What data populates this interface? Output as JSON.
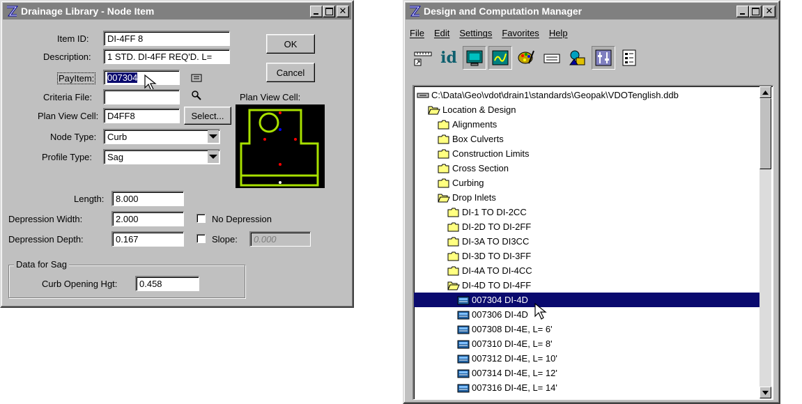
{
  "dialog": {
    "title": "Drainage Library - Node Item",
    "item_id_label": "Item ID:",
    "item_id_value": "DI-4FF 8",
    "description_label": "Description:",
    "description_value": "1 STD. DI-4FF REQ'D. L=",
    "payitem_label": "PayItem:",
    "payitem_value": "007304",
    "criteria_label": "Criteria File:",
    "criteria_value": "",
    "plan_view_cell_label": "Plan View Cell:",
    "plan_view_cell_value": "D4FF8",
    "select_label": "Select...",
    "ok_label": "OK",
    "cancel_label": "Cancel",
    "preview_label": "Plan View Cell:",
    "node_type_label": "Node Type:",
    "node_type_value": "Curb",
    "profile_type_label": "Profile Type:",
    "profile_type_value": "Sag",
    "length_label": "Length:",
    "length_value": "8.000",
    "dep_width_label": "Depression Width:",
    "dep_width_value": "2.000",
    "no_depression_label": "No Depression",
    "dep_depth_label": "Depression Depth:",
    "dep_depth_value": "0.167",
    "slope_label": "Slope:",
    "slope_value": "0.000",
    "group_title": "Data for Sag",
    "curb_opening_label": "Curb Opening Hgt:",
    "curb_opening_value": "0.458"
  },
  "manager": {
    "title": "Design and Computation Manager",
    "menu": [
      "File",
      "Edit",
      "Settings",
      "Favorites",
      "Help"
    ],
    "toolbar_icons": [
      "ruler-icon",
      "id-icon",
      "monitor-icon",
      "draw-icon",
      "palette-icon",
      "keyboard-icon",
      "shapes-icon",
      "settings-icon",
      "properties-icon"
    ],
    "id_text": "id",
    "tree": [
      {
        "label": "C:\\Data\\Geo\\vdot\\drain1\\standards\\Geopak\\VDOTenglish.ddb",
        "level": 0,
        "icon": "database",
        "selected": false
      },
      {
        "label": "Location & Design",
        "level": 1,
        "icon": "folder-open",
        "selected": false
      },
      {
        "label": "Alignments",
        "level": 2,
        "icon": "folder",
        "selected": false
      },
      {
        "label": "Box Culverts",
        "level": 2,
        "icon": "folder",
        "selected": false
      },
      {
        "label": "Construction Limits",
        "level": 2,
        "icon": "folder",
        "selected": false
      },
      {
        "label": "Cross Section",
        "level": 2,
        "icon": "folder",
        "selected": false
      },
      {
        "label": "Curbing",
        "level": 2,
        "icon": "folder",
        "selected": false
      },
      {
        "label": "Drop Inlets",
        "level": 2,
        "icon": "folder-open",
        "selected": false
      },
      {
        "label": "DI-1 TO DI-2CC",
        "level": 3,
        "icon": "folder",
        "selected": false
      },
      {
        "label": "DI-2D TO DI-2FF",
        "level": 3,
        "icon": "folder",
        "selected": false
      },
      {
        "label": "DI-3A TO DI3CC",
        "level": 3,
        "icon": "folder",
        "selected": false
      },
      {
        "label": "DI-3D TO DI-3FF",
        "level": 3,
        "icon": "folder",
        "selected": false
      },
      {
        "label": "DI-4A TO DI-4CC",
        "level": 3,
        "icon": "folder",
        "selected": false
      },
      {
        "label": "DI-4D TO DI-4FF",
        "level": 3,
        "icon": "folder-open",
        "selected": false
      },
      {
        "label": "007304 DI-4D",
        "level": 4,
        "icon": "item",
        "selected": true
      },
      {
        "label": "007306 DI-4D",
        "level": 4,
        "icon": "item",
        "selected": false
      },
      {
        "label": "007308 DI-4E, L= 6'",
        "level": 4,
        "icon": "item",
        "selected": false
      },
      {
        "label": "007310 DI-4E, L= 8'",
        "level": 4,
        "icon": "item",
        "selected": false
      },
      {
        "label": "007312 DI-4E, L= 10'",
        "level": 4,
        "icon": "item",
        "selected": false
      },
      {
        "label": "007314 DI-4E, L= 12'",
        "level": 4,
        "icon": "item",
        "selected": false
      },
      {
        "label": "007316 DI-4E, L= 14'",
        "level": 4,
        "icon": "item",
        "selected": false
      }
    ]
  },
  "colors": {
    "title_inactive": "#808080",
    "selection": "#0a0a6e",
    "cell_green": "#a8e000",
    "cell_red": "#ff0000",
    "cell_blue": "#0000ff"
  }
}
